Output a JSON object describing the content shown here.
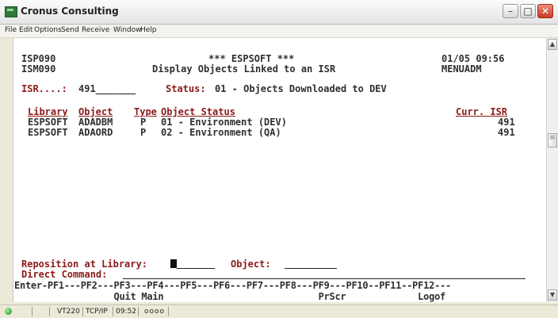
{
  "window": {
    "title": "Cronus Consulting"
  },
  "menu": [
    "File",
    "Edit",
    "Options",
    "Send",
    "Receive",
    "Window",
    "Help"
  ],
  "screen": {
    "program": "ISP090",
    "format": "ISM090",
    "app_name": "*** ESPSOFT ***",
    "subtitle": "Display Objects Linked to an ISR",
    "datetime": "01/05 09:56",
    "menu_name": "MENUADM",
    "isr_label": "ISR....:",
    "isr_value": "491_______",
    "status_label": "Status:",
    "status_value": "01 - Objects Downloaded to DEV",
    "columns": {
      "library": "Library",
      "object": "Object",
      "type": "Type",
      "status": "Object Status",
      "curr_isr": "Curr. ISR"
    },
    "rows": [
      {
        "library": "ESPSOFT",
        "object": "ADADBM",
        "type": "P",
        "status": "01 - Environment (DEV)",
        "curr_isr": "491"
      },
      {
        "library": "ESPSOFT",
        "object": "ADAORD",
        "type": "P",
        "status": "02 - Environment (QA)",
        "curr_isr": "491"
      }
    ],
    "reposition_label": "Reposition at Library:",
    "object_label": "Object:",
    "direct_command_label": "Direct Command:",
    "fkey_line": "Enter-PF1---PF2---PF3---PF4---PF5---PF6---PF7---PF8---PF9---PF10--PF11--PF12---",
    "fkey_desc_line": "                  Quit Main                            PrScr             Logof"
  },
  "statusbar": {
    "emulation": "VT220",
    "protocol": "TCP/IP",
    "time": "09:52",
    "indicators": "oooo"
  }
}
